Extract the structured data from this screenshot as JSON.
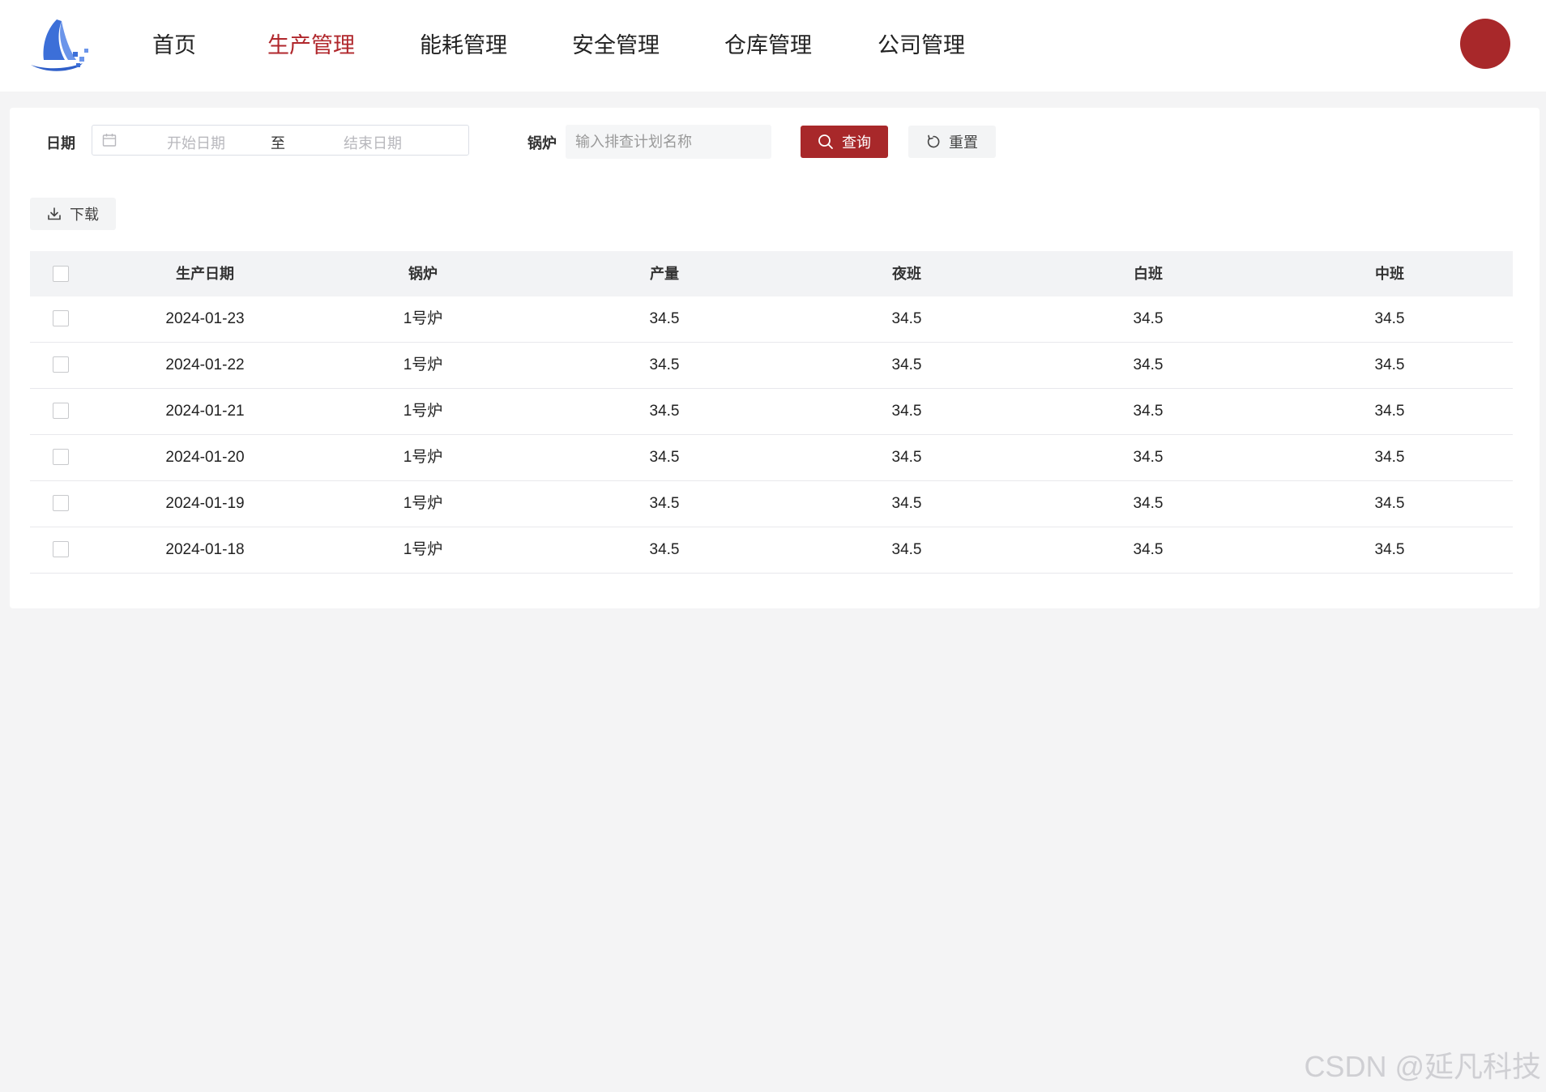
{
  "header": {
    "nav": [
      {
        "label": "首页",
        "active": false
      },
      {
        "label": "生产管理",
        "active": true
      },
      {
        "label": "能耗管理",
        "active": false
      },
      {
        "label": "安全管理",
        "active": false
      },
      {
        "label": "仓库管理",
        "active": false
      },
      {
        "label": "公司管理",
        "active": false
      }
    ],
    "avatar_color": "#a8282a",
    "accent_color": "#b0272c"
  },
  "filters": {
    "date_label": "日期",
    "start_placeholder": "开始日期",
    "range_separator": "至",
    "end_placeholder": "结束日期",
    "boiler_label": "锅炉",
    "boiler_placeholder": "输入排查计划名称",
    "query_label": "查询",
    "reset_label": "重置"
  },
  "toolbar": {
    "download_label": "下载"
  },
  "table": {
    "columns": [
      "生产日期",
      "锅炉",
      "产量",
      "夜班",
      "白班",
      "中班"
    ],
    "rows": [
      [
        "2024-01-23",
        "1号炉",
        "34.5",
        "34.5",
        "34.5",
        "34.5"
      ],
      [
        "2024-01-22",
        "1号炉",
        "34.5",
        "34.5",
        "34.5",
        "34.5"
      ],
      [
        "2024-01-21",
        "1号炉",
        "34.5",
        "34.5",
        "34.5",
        "34.5"
      ],
      [
        "2024-01-20",
        "1号炉",
        "34.5",
        "34.5",
        "34.5",
        "34.5"
      ],
      [
        "2024-01-19",
        "1号炉",
        "34.5",
        "34.5",
        "34.5",
        "34.5"
      ],
      [
        "2024-01-18",
        "1号炉",
        "34.5",
        "34.5",
        "34.5",
        "34.5"
      ]
    ]
  },
  "watermark": "CSDN @延凡科技"
}
